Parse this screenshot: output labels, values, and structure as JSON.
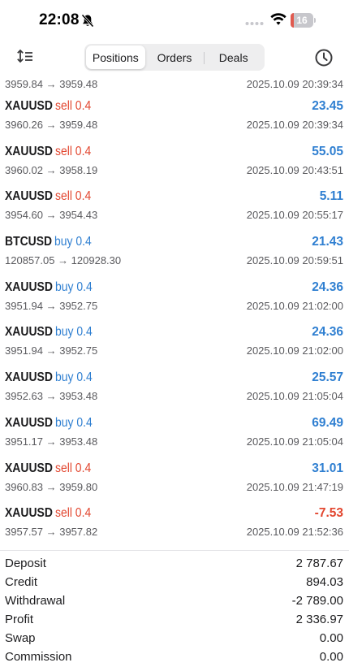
{
  "status_bar": {
    "time": "22:08",
    "battery_level": "16",
    "battery_fraction": 0.16
  },
  "toolbar": {
    "tabs": [
      {
        "label": "Positions",
        "active": true
      },
      {
        "label": "Orders",
        "active": false
      },
      {
        "label": "Deals",
        "active": false
      }
    ],
    "sort_icon": "sort-icon",
    "history_icon": "clock-icon"
  },
  "deals_partial": {
    "prices": "3959.84 → 3959.48",
    "time": "2025.10.09 20:39:34"
  },
  "deals": [
    {
      "symbol": "XAUUSD",
      "type": "sell 0.4",
      "direction": "sell",
      "profit": "23.45",
      "prices": "3960.26 → 3959.48",
      "time": "2025.10.09 20:39:34"
    },
    {
      "symbol": "XAUUSD",
      "type": "sell 0.4",
      "direction": "sell",
      "profit": "55.05",
      "prices": "3960.02 → 3958.19",
      "time": "2025.10.09 20:43:51"
    },
    {
      "symbol": "XAUUSD",
      "type": "sell 0.4",
      "direction": "sell",
      "profit": "5.11",
      "prices": "3954.60 → 3954.43",
      "time": "2025.10.09 20:55:17"
    },
    {
      "symbol": "BTCUSD",
      "type": "buy 0.4",
      "direction": "buy",
      "profit": "21.43",
      "prices": "120857.05 → 120928.30",
      "time": "2025.10.09 20:59:51"
    },
    {
      "symbol": "XAUUSD",
      "type": "buy 0.4",
      "direction": "buy",
      "profit": "24.36",
      "prices": "3951.94 → 3952.75",
      "time": "2025.10.09 21:02:00"
    },
    {
      "symbol": "XAUUSD",
      "type": "buy 0.4",
      "direction": "buy",
      "profit": "24.36",
      "prices": "3951.94 → 3952.75",
      "time": "2025.10.09 21:02:00"
    },
    {
      "symbol": "XAUUSD",
      "type": "buy 0.4",
      "direction": "buy",
      "profit": "25.57",
      "prices": "3952.63 → 3953.48",
      "time": "2025.10.09 21:05:04"
    },
    {
      "symbol": "XAUUSD",
      "type": "buy 0.4",
      "direction": "buy",
      "profit": "69.49",
      "prices": "3951.17 → 3953.48",
      "time": "2025.10.09 21:05:04"
    },
    {
      "symbol": "XAUUSD",
      "type": "sell 0.4",
      "direction": "sell",
      "profit": "31.01",
      "prices": "3960.83 → 3959.80",
      "time": "2025.10.09 21:47:19"
    },
    {
      "symbol": "XAUUSD",
      "type": "sell 0.4",
      "direction": "sell",
      "profit": "-7.53",
      "prices": "3957.57 → 3957.82",
      "time": "2025.10.09 21:52:36"
    }
  ],
  "summary": [
    {
      "label": "Deposit",
      "value": "2 787.67"
    },
    {
      "label": "Credit",
      "value": "894.03"
    },
    {
      "label": "Withdrawal",
      "value": "-2 789.00"
    },
    {
      "label": "Profit",
      "value": "2 336.97"
    },
    {
      "label": "Swap",
      "value": "0.00"
    },
    {
      "label": "Commission",
      "value": "0.00"
    }
  ],
  "colors": {
    "sell": "#e2462f",
    "buy": "#2f7fd1",
    "profit_positive": "#2f7fd1",
    "profit_negative": "#e2462f",
    "battery_low": "#e05a4f"
  }
}
